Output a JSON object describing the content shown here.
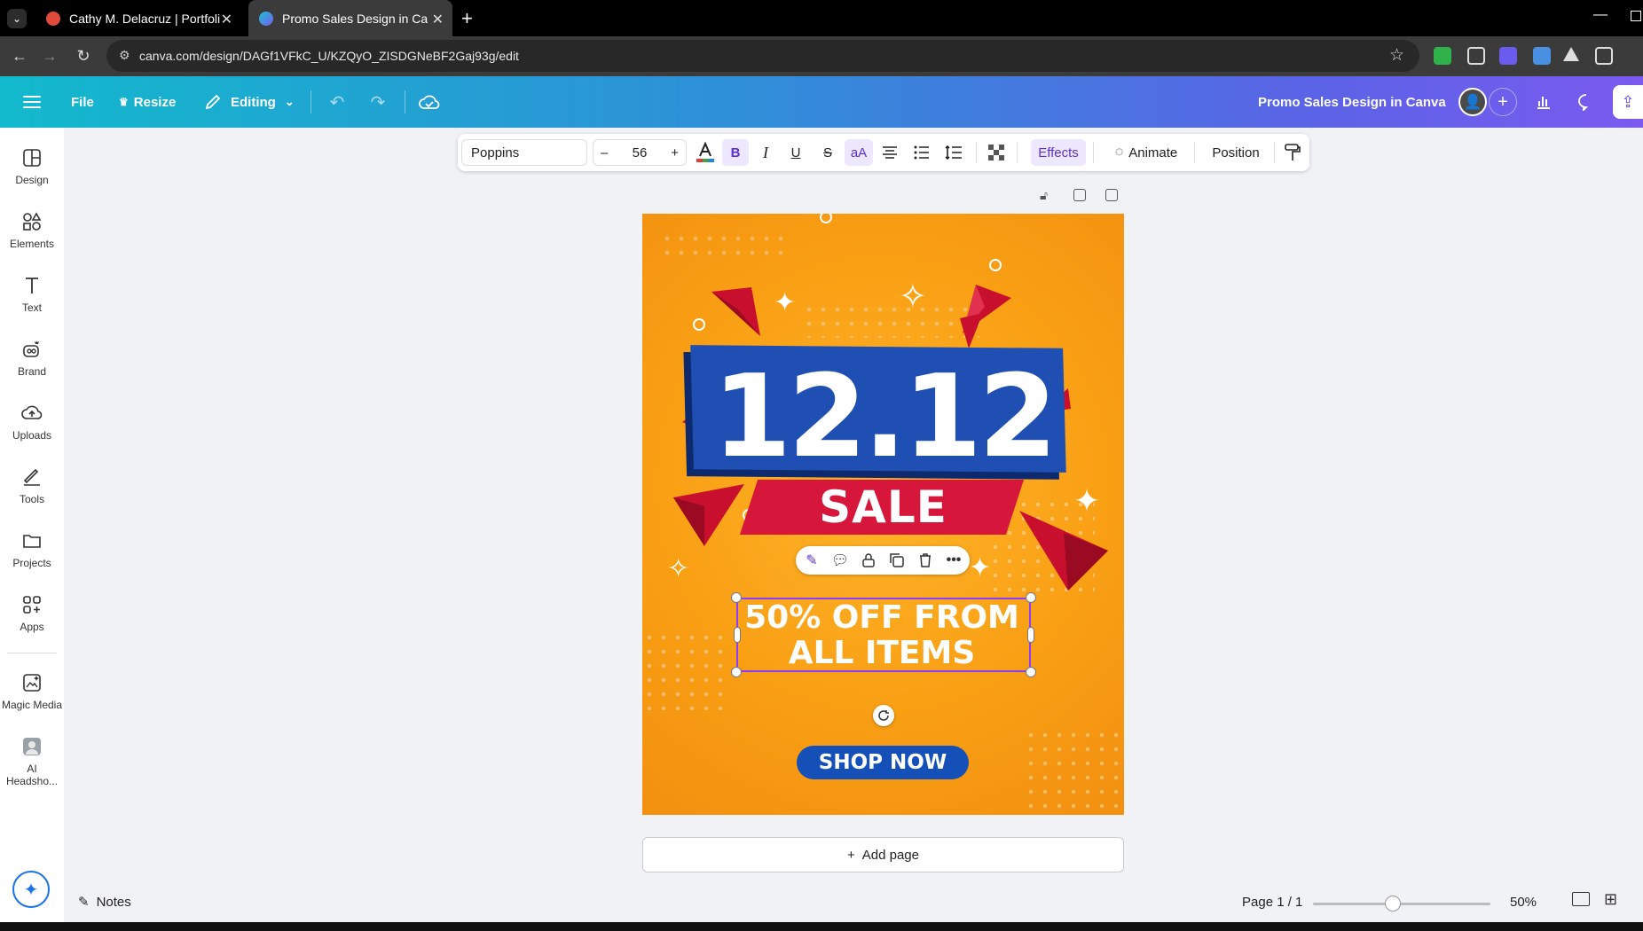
{
  "browser": {
    "tabs": [
      {
        "title": "Cathy M. Delacruz | Portfolio",
        "active": false
      },
      {
        "title": "Promo Sales Design in Canva - ",
        "active": true
      }
    ],
    "new_tab": "+",
    "url": "canva.com/design/DAGf1VFkC_U/KZQyO_ZISDGNeBF2Gaj93g/edit"
  },
  "header": {
    "file": "File",
    "resize": "Resize",
    "editing": "Editing",
    "doc_title": "Promo Sales Design in Canva"
  },
  "rail": [
    {
      "label": "Design",
      "icon": "layout-icon"
    },
    {
      "label": "Elements",
      "icon": "shapes-icon"
    },
    {
      "label": "Text",
      "icon": "text-icon"
    },
    {
      "label": "Brand",
      "icon": "brand-icon"
    },
    {
      "label": "Uploads",
      "icon": "cloud-upload-icon"
    },
    {
      "label": "Tools",
      "icon": "pen-icon"
    },
    {
      "label": "Projects",
      "icon": "folder-icon"
    },
    {
      "label": "Apps",
      "icon": "apps-icon"
    },
    {
      "label": "Magic Media",
      "icon": "magic-media-icon"
    },
    {
      "label": "AI Headsho...",
      "icon": "ai-headshot-icon"
    }
  ],
  "toolbar": {
    "font": "Poppins",
    "size": "56",
    "minus": "–",
    "plus": "+",
    "effects": "Effects",
    "animate": "Animate",
    "position": "Position"
  },
  "design": {
    "headline": "12.12",
    "sale": "SALE",
    "offer_line1": "50% OFF FROM",
    "offer_line2": "ALL ITEMS",
    "cta": "SHOP NOW"
  },
  "add_page": "Add page",
  "footer": {
    "notes": "Notes",
    "page": "Page 1 / 1",
    "zoom": "50%",
    "zoom_fraction": 0.45
  },
  "colors": {
    "accent": "#8b3dff",
    "orange": "#f99f14",
    "blue": "#1f4fb3",
    "red": "#d6173b"
  }
}
